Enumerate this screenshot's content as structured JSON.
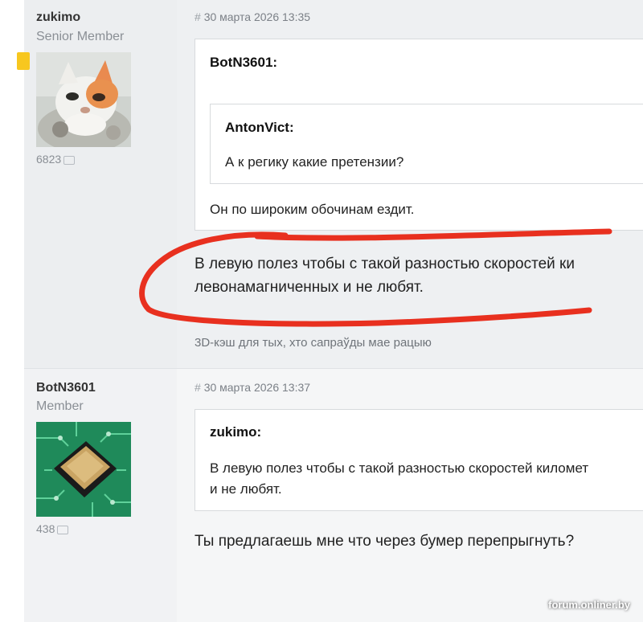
{
  "posts": [
    {
      "author": {
        "name": "zukimo",
        "rank": "Senior Member",
        "post_count": "6823"
      },
      "date": "30 марта 2026 13:35",
      "quote": {
        "author": "BotN3601:",
        "nested_quote": {
          "author": "AntonVict:",
          "text": "А к регику какие претензии?"
        },
        "text": "Он по широким обочинам ездит."
      },
      "body_lines": [
        "В левую полез чтобы с такой разностью скоростей ки",
        "левонамагниченных и не любят."
      ],
      "signature": "3D-кэш для тых, хто сапраўды мае рацыю"
    },
    {
      "author": {
        "name": "BotN3601",
        "rank": "Member",
        "post_count": "438"
      },
      "date": "30 марта 2026 13:37",
      "quote": {
        "author": "zukimo:",
        "text_lines": [
          "В левую полез чтобы с такой разностью скоростей километ",
          "и не любят."
        ]
      },
      "body": "Ты предлагаешь мне что через бумер перепрыгнуть?"
    }
  ],
  "hash_symbol": "#",
  "watermark": "forum.onliner.by",
  "colors": {
    "annotation_red": "#e8301f",
    "tag_yellow": "#f7c71f"
  }
}
